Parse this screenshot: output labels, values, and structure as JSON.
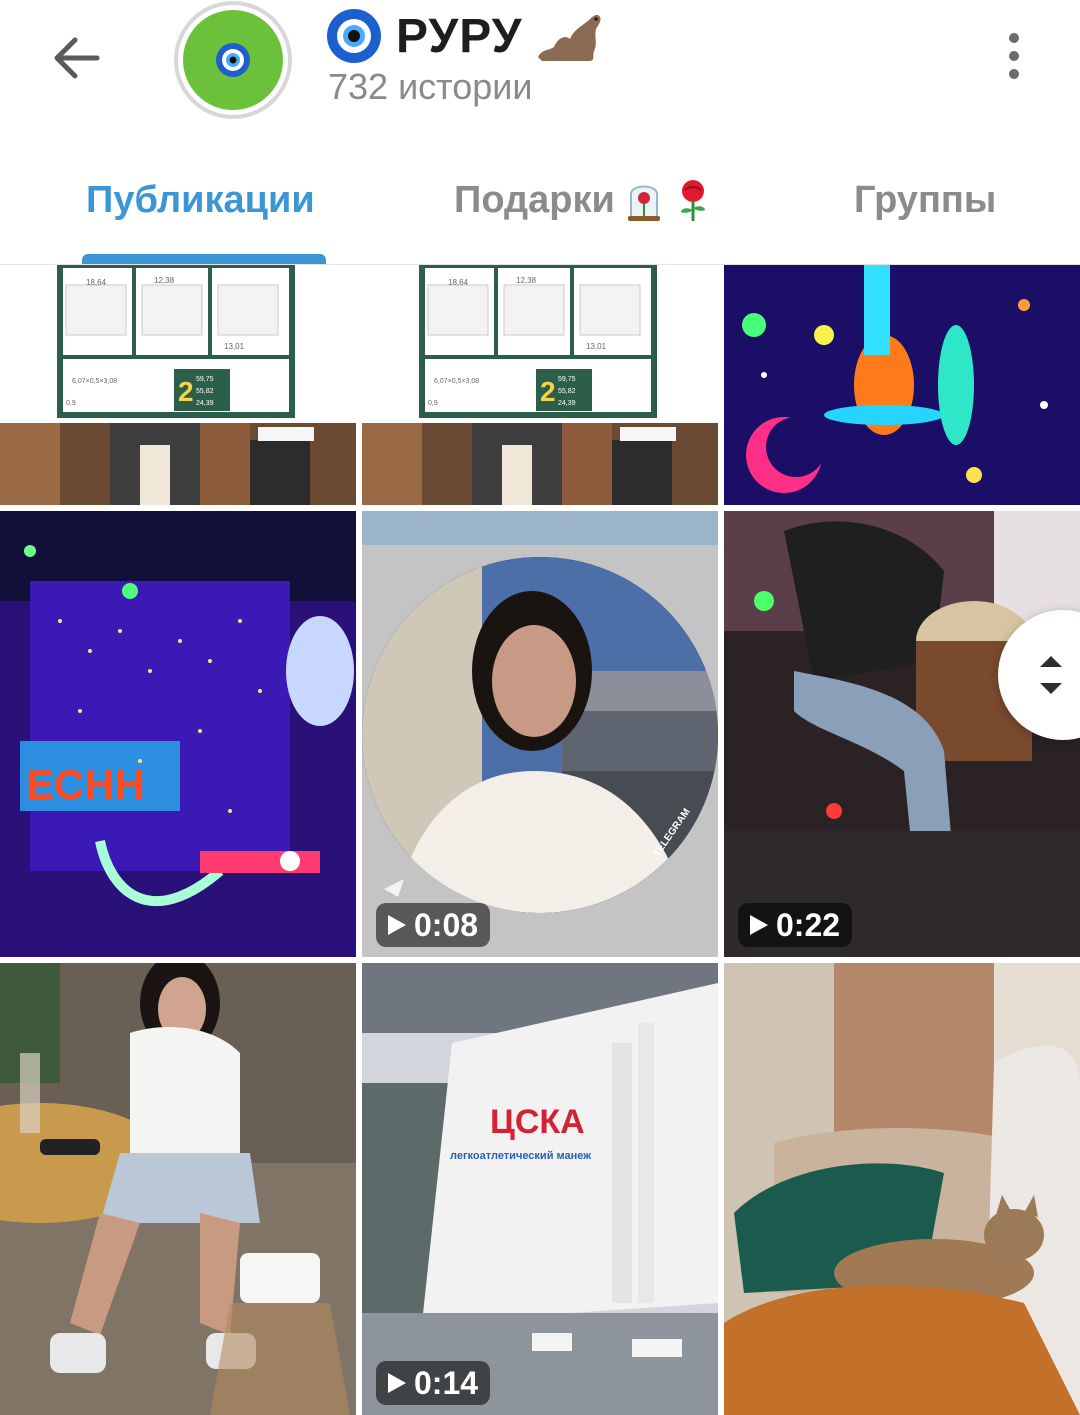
{
  "header": {
    "back_icon": "arrow-left-icon",
    "avatar_icon": "evil-eye-icon",
    "title_emoji": "nazar-amulet-icon",
    "title": "РУРУ",
    "title_suffix_icon": "camel-icon",
    "subtitle": "732 истории",
    "menu_icon": "more-vertical-icon"
  },
  "tabs": [
    {
      "label": "Публикации",
      "active": true
    },
    {
      "label": "Подарки",
      "active": false,
      "icons": [
        "rose-dome-icon",
        "rose-icon"
      ]
    },
    {
      "label": "Группы",
      "active": false
    }
  ],
  "colors": {
    "accent": "#3c96d6",
    "avatar_bg": "#6cc13a",
    "tab_inactive": "#8b8b8b",
    "subtitle": "#8a8a8a"
  },
  "grid": {
    "items": [
      {
        "kind": "photo",
        "subject": "floor plan apartment",
        "plan_numbers": [
          "18,64",
          "12,38",
          "13,01",
          "2",
          "59,75",
          "55,82",
          "24,39",
          "6,07×0,5×3,08",
          "0,9"
        ]
      },
      {
        "kind": "photo",
        "subject": "floor plan apartment",
        "plan_numbers": [
          "18,64",
          "12,38",
          "13,01",
          "2",
          "59,75",
          "55,82",
          "24,39",
          "6,07×0,5×3,08",
          "0,9"
        ]
      },
      {
        "kind": "photo",
        "subject": "neon space art"
      },
      {
        "kind": "photo",
        "subject": "neon lights room"
      },
      {
        "kind": "video",
        "subject": "round selfie",
        "duration": "0:08",
        "watermark": "TELEGRAM"
      },
      {
        "kind": "video",
        "subject": "drummer",
        "duration": "0:22"
      },
      {
        "kind": "photo",
        "subject": "woman at table"
      },
      {
        "kind": "video",
        "subject": "building",
        "duration": "0:14",
        "sign": "ЦСКА",
        "sign_sub": "легкоатлетический манеж"
      },
      {
        "kind": "photo",
        "subject": "cat on sofa"
      }
    ]
  },
  "scroll_handle_icon": "scroll-up-down-icon"
}
